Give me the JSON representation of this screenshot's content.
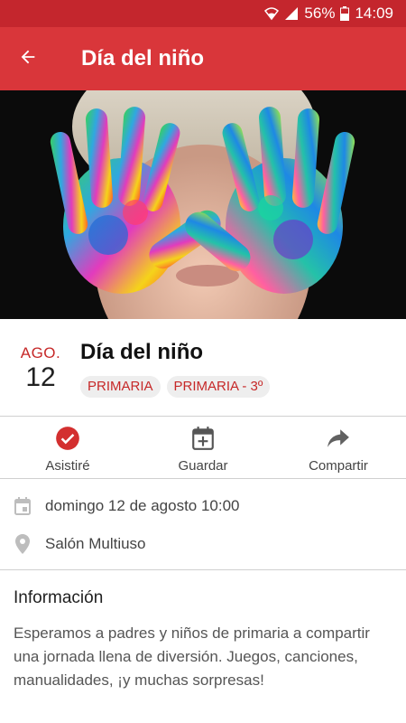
{
  "status_bar": {
    "battery": "56%",
    "time": "14:09"
  },
  "app_bar": {
    "title": "Día del niño",
    "back_icon": "arrow-left-icon"
  },
  "hero_image": {
    "description_icon": "child-painted-hands-photo"
  },
  "event": {
    "month": "AGO.",
    "day": "12",
    "title": "Día del niño",
    "tags": [
      "PRIMARIA",
      "PRIMARIA - 3º"
    ]
  },
  "actions": [
    {
      "label": "Asistiré",
      "icon": "check-circle-icon"
    },
    {
      "label": "Guardar",
      "icon": "calendar-add-icon"
    },
    {
      "label": "Compartir",
      "icon": "share-icon"
    }
  ],
  "details": {
    "datetime": "domingo 12 de agosto 10:00",
    "location": "Salón Multiuso"
  },
  "info": {
    "heading": "Información",
    "body": "Esperamos a padres y niños de primaria a compartir una jornada llena de diversión. Juegos, canciones, manualidades, ¡y muchas sorpresas!"
  },
  "colors": {
    "primary": "#d9363a",
    "primary_dark": "#c4262d",
    "accent_text": "#c62828"
  }
}
